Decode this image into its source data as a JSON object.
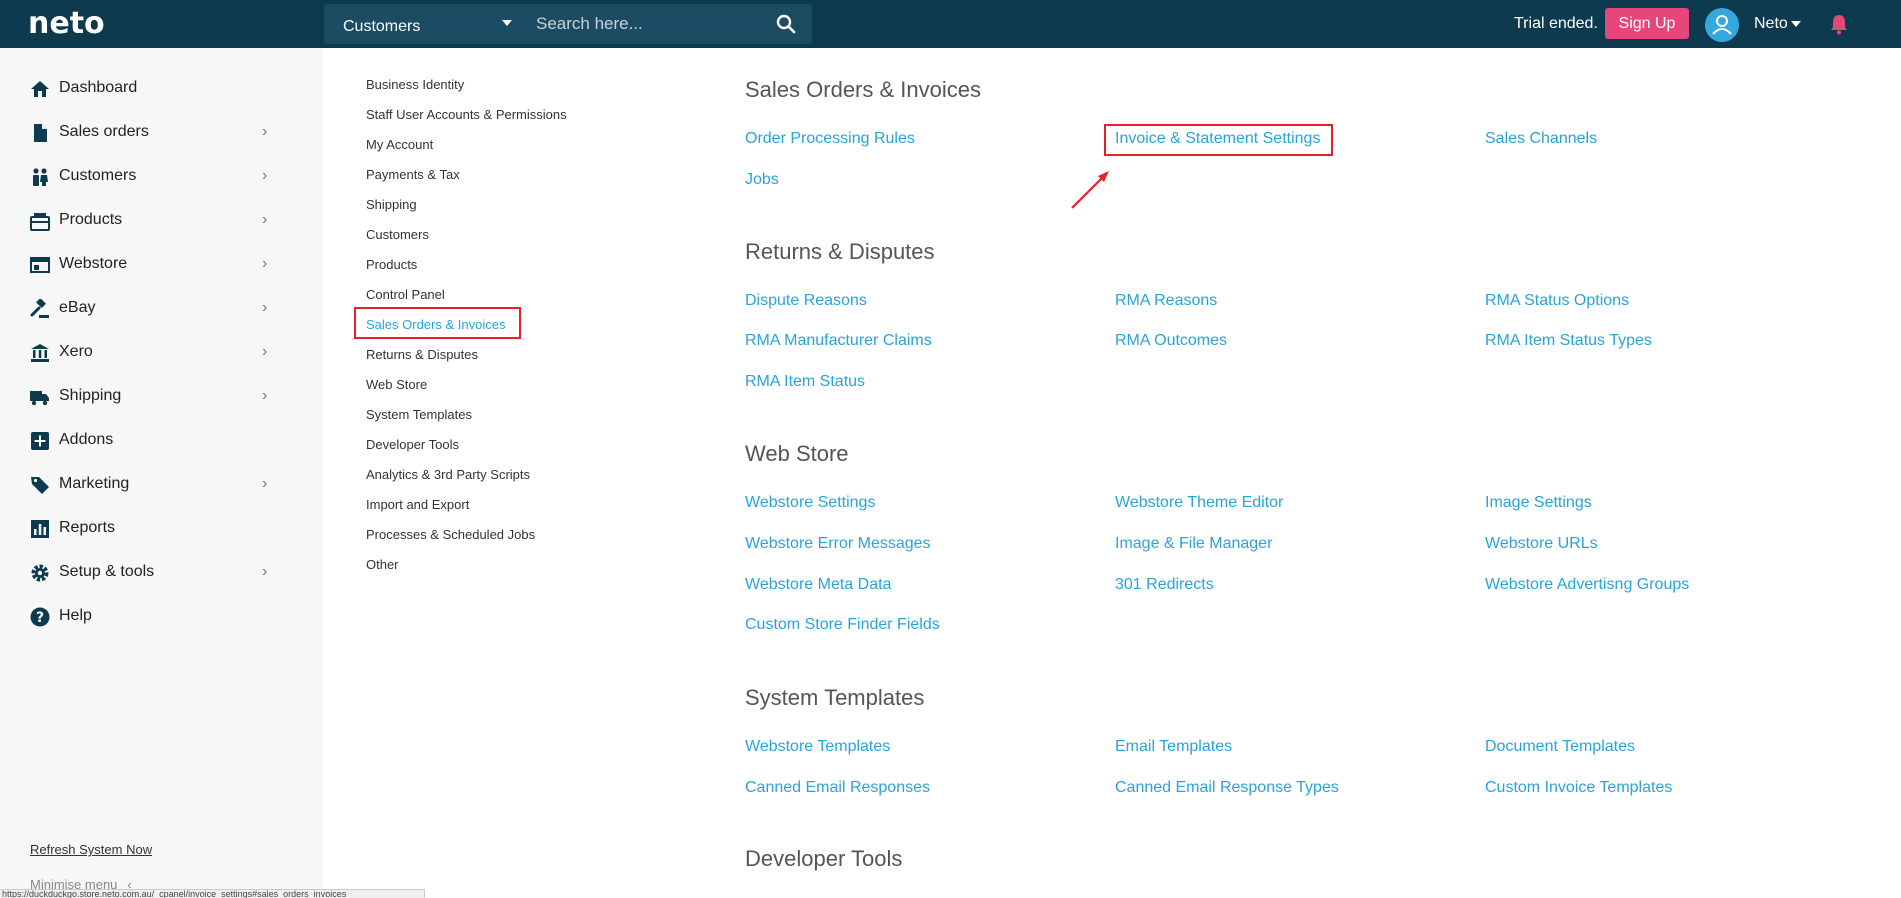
{
  "topbar": {
    "logo": "neto",
    "search_scope": "Customers",
    "search_placeholder": "Search here...",
    "trial_text": "Trial ended.",
    "signup_label": "Sign Up",
    "user_name": "Neto"
  },
  "sidebar": {
    "items": [
      {
        "label": "Dashboard",
        "icon": "home-icon"
      },
      {
        "label": "Sales orders",
        "icon": "document-icon"
      },
      {
        "label": "Customers",
        "icon": "people-icon"
      },
      {
        "label": "Products",
        "icon": "products-icon"
      },
      {
        "label": "Webstore",
        "icon": "webstore-icon"
      },
      {
        "label": "eBay",
        "icon": "gavel-icon"
      },
      {
        "label": "Xero",
        "icon": "bank-icon"
      },
      {
        "label": "Shipping",
        "icon": "truck-icon"
      },
      {
        "label": "Addons",
        "icon": "plus-square-icon"
      },
      {
        "label": "Marketing",
        "icon": "tag-icon"
      },
      {
        "label": "Reports",
        "icon": "chart-icon"
      },
      {
        "label": "Setup & tools",
        "icon": "gear-icon"
      },
      {
        "label": "Help",
        "icon": "help-icon"
      }
    ],
    "refresh_label": "Refresh System Now",
    "minimise_label": "Minimise menu"
  },
  "settings_nav": {
    "items": [
      "Business Identity",
      "Staff User Accounts & Permissions",
      "My Account",
      "Payments & Tax",
      "Shipping",
      "Customers",
      "Products",
      "Control Panel",
      "Sales Orders & Invoices",
      "Returns & Disputes",
      "Web Store",
      "System Templates",
      "Developer Tools",
      "Analytics & 3rd Party Scripts",
      "Import and Export",
      "Processes & Scheduled Jobs",
      "Other"
    ],
    "active": "Sales Orders & Invoices"
  },
  "sections": [
    {
      "title": "Sales Orders & Invoices",
      "links": [
        "Order Processing Rules",
        "Invoice & Statement Settings",
        "Sales Channels",
        "Jobs"
      ]
    },
    {
      "title": "Returns & Disputes",
      "links": [
        "Dispute Reasons",
        "RMA Reasons",
        "RMA Status Options",
        "RMA Manufacturer Claims",
        "RMA Outcomes",
        "RMA Item Status Types",
        "RMA Item Status"
      ]
    },
    {
      "title": "Web Store",
      "links": [
        "Webstore Settings",
        "Webstore Theme Editor",
        "Image Settings",
        "Webstore Error Messages",
        "Image & File Manager",
        "Webstore URLs",
        "Webstore Meta Data",
        "301 Redirects",
        "Webstore Advertisng Groups",
        "Custom Store Finder Fields"
      ]
    },
    {
      "title": "System Templates",
      "links": [
        "Webstore Templates",
        "Email Templates",
        "Document Templates",
        "Canned Email Responses",
        "Canned Email Response Types",
        "Custom Invoice Templates"
      ]
    },
    {
      "title": "Developer Tools",
      "links": []
    }
  ],
  "status_bar": "https://duckduckgo.store.neto.com.au/_cpanel/invoice_settings#sales_orders_invoices",
  "colors": {
    "topbar": "#0e3a4f",
    "link": "#2aa3d9",
    "signup": "#e6467a",
    "highlight": "#e8202a",
    "bell": "#e6467a"
  }
}
